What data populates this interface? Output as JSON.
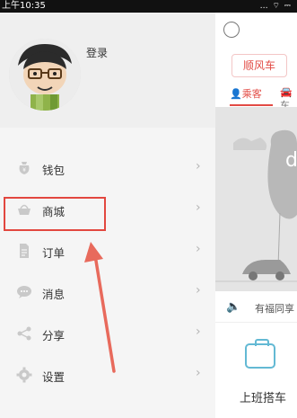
{
  "status_bar": {
    "time": "上午10:35",
    "icons": "… ⌔ ⎓"
  },
  "drawer": {
    "login_label": "登录",
    "menu": [
      {
        "label": "钱包",
        "icon": "wallet-icon"
      },
      {
        "label": "商城",
        "icon": "shop-basket-icon"
      },
      {
        "label": "订单",
        "icon": "order-document-icon"
      },
      {
        "label": "消息",
        "icon": "message-bubble-icon"
      },
      {
        "label": "分享",
        "icon": "share-icon"
      },
      {
        "label": "设置",
        "icon": "settings-gear-icon"
      }
    ],
    "chevron": "›"
  },
  "content": {
    "ride_tab_label": "顺风车",
    "passenger_tab_label": "乘客",
    "passenger_icon": "👤",
    "driver_icon_text": "🚘车",
    "notice_text": "有福同享",
    "speaker_icon": "🔈",
    "commute_label": "上班搭车"
  },
  "colors": {
    "accent_red": "#e24b45",
    "highlight_box": "#e2473f",
    "annotation_arrow": "#e86a5c",
    "commute_icon": "#63b9d4"
  }
}
